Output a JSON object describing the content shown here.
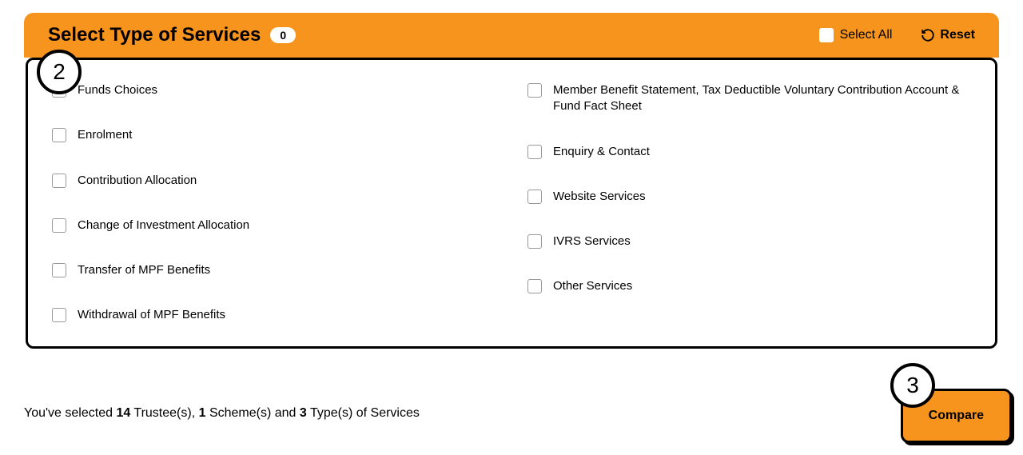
{
  "header": {
    "title": "Select Type of Services",
    "count": "0",
    "select_all_label": "Select All",
    "reset_label": "Reset"
  },
  "options": {
    "left": [
      "Funds Choices",
      "Enrolment",
      "Contribution Allocation",
      "Change of Investment Allocation",
      "Transfer of MPF Benefits",
      "Withdrawal of MPF Benefits"
    ],
    "right": [
      "Member Benefit Statement, Tax Deductible Voluntary Contribution Account & Fund Fact Sheet",
      "Enquiry & Contact",
      "Website Services",
      "IVRS Services",
      "Other Services"
    ]
  },
  "steps": {
    "two": "2",
    "three": "3"
  },
  "footer": {
    "prefix": "You've selected ",
    "trustee_count": "14",
    "trustee_label": " Trustee(s), ",
    "scheme_count": "1",
    "scheme_label": " Scheme(s) and ",
    "service_count": "3",
    "service_label": " Type(s) of Services",
    "compare_label": "Compare"
  }
}
